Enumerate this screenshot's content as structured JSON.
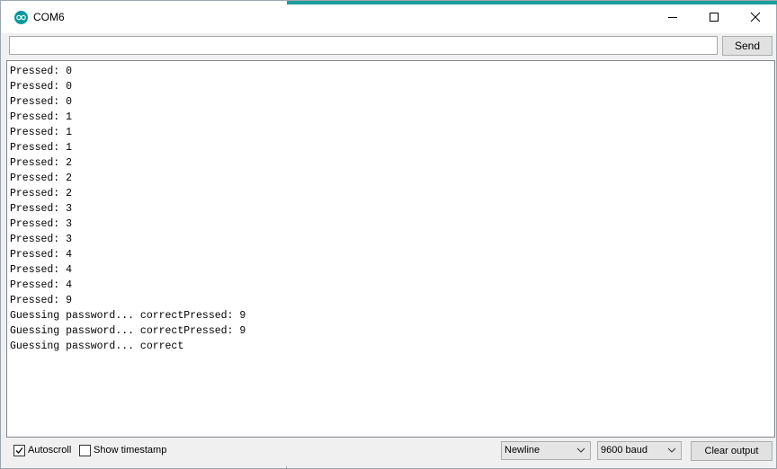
{
  "window": {
    "title": "COM6",
    "app_icon": "arduino-icon",
    "accent_color": "#1b9e9a"
  },
  "controls": {
    "minimize_icon": "minimize-icon",
    "maximize_icon": "maximize-icon",
    "close_icon": "close-icon"
  },
  "send_bar": {
    "input_value": "",
    "send_label": "Send"
  },
  "output": {
    "lines": [
      "Pressed: 0",
      "Pressed: 0",
      "Pressed: 0",
      "Pressed: 1",
      "Pressed: 1",
      "Pressed: 1",
      "Pressed: 2",
      "Pressed: 2",
      "Pressed: 2",
      "Pressed: 3",
      "Pressed: 3",
      "Pressed: 3",
      "Pressed: 4",
      "Pressed: 4",
      "Pressed: 4",
      "Pressed: 9",
      "Guessing password... correctPressed: 9",
      "Guessing password... correctPressed: 9",
      "Guessing password... correct"
    ]
  },
  "footer": {
    "autoscroll_label": "Autoscroll",
    "autoscroll_checked": true,
    "timestamp_label": "Show timestamp",
    "timestamp_checked": false,
    "line_ending": "Newline",
    "baud_rate": "9600 baud",
    "clear_label": "Clear output"
  }
}
